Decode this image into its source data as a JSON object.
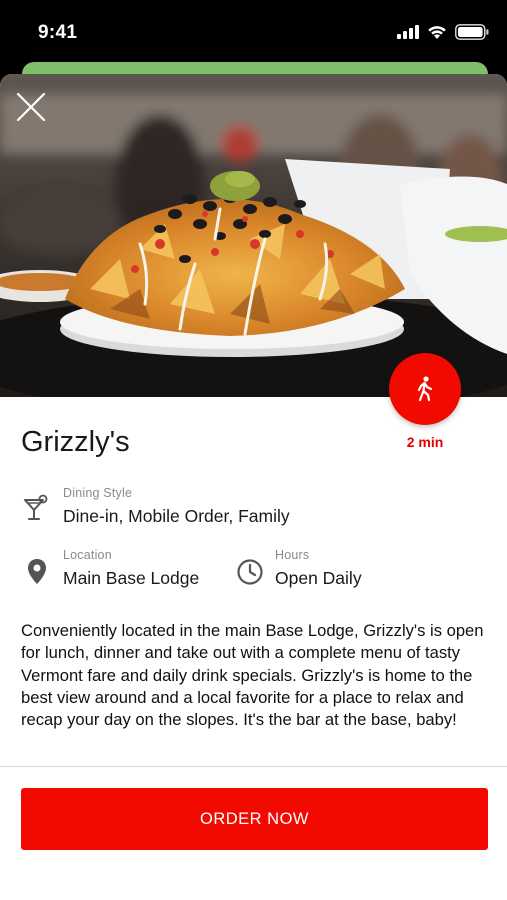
{
  "status_bar": {
    "time": "9:41"
  },
  "hero": {
    "alt": "Plate of nachos"
  },
  "walk": {
    "time": "2 min",
    "icon": "walking-person-icon"
  },
  "restaurant": {
    "name": "Grizzly's",
    "dining_style": {
      "label": "Dining Style",
      "value": "Dine-in, Mobile Order, Family",
      "icon": "cocktail-icon"
    },
    "location": {
      "label": "Location",
      "value": "Main Base Lodge",
      "icon": "location-pin-icon"
    },
    "hours": {
      "label": "Hours",
      "value": "Open Daily",
      "icon": "clock-icon"
    },
    "description": "Conveniently located in the main Base Lodge, Grizzly's is open for lunch, dinner and take out with a complete menu of tasty Vermont fare and daily drink specials. Grizzly's is home to the best view around and a local favorite for a place to relax and recap your day on the slopes. It's the bar at the base, baby!"
  },
  "actions": {
    "order_label": "ORDER NOW"
  },
  "colors": {
    "accent": "#f20a00",
    "label": "#8a8a8a",
    "text": "#1a1a1a"
  }
}
